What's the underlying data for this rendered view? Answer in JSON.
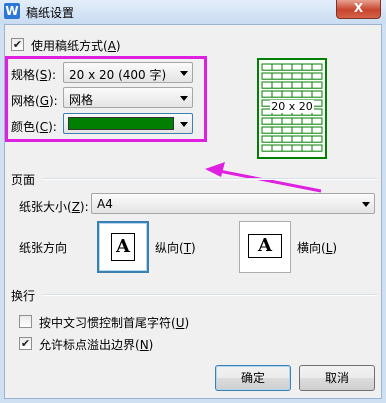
{
  "window": {
    "title": "稿纸设置",
    "app_icon_letter": "W",
    "close_glyph": "X"
  },
  "use_manuscript": {
    "label": "使用稿纸方式(",
    "key": "A",
    "label_end": ")",
    "checked": true
  },
  "spec": {
    "label": "规格(",
    "key": "S",
    "label_end": "):",
    "value": "20 x 20 (400 字)"
  },
  "grid": {
    "label": "网格(",
    "key": "G",
    "label_end": "):",
    "value": "网格"
  },
  "color": {
    "label": "颜色(",
    "key": "C",
    "label_end": "):",
    "value_hex": "#007f00"
  },
  "preview": {
    "label": "20 x 20",
    "line_color": "#007f00"
  },
  "page_group": {
    "title": "页面",
    "paper_size": {
      "label": "纸张大小(",
      "key": "Z",
      "label_end": "):",
      "value": "A4"
    },
    "orientation": {
      "label": "纸张方向",
      "portrait": {
        "label": "纵向(",
        "key": "T",
        "label_end": ")",
        "selected": true,
        "icon_letter": "A"
      },
      "landscape": {
        "label": "横向(",
        "key": "L",
        "label_end": ")",
        "selected": false,
        "icon_letter": "A"
      }
    }
  },
  "line_break_group": {
    "title": "换行",
    "opt1": {
      "label": "按中文习惯控制首尾字符(",
      "key": "U",
      "label_end": ")",
      "checked": false
    },
    "opt2": {
      "label": "允许标点溢出边界(",
      "key": "N",
      "label_end": ")",
      "checked": true
    }
  },
  "buttons": {
    "ok": "确定",
    "cancel": "取消"
  },
  "annotation_color": "#e020e0"
}
